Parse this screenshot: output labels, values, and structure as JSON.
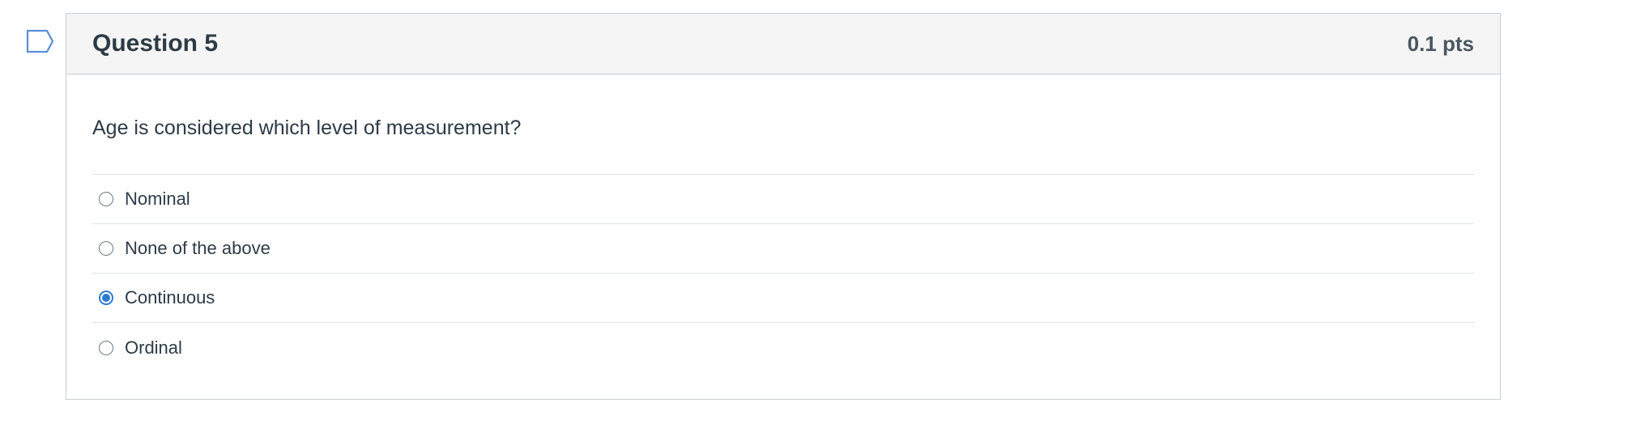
{
  "question": {
    "title": "Question 5",
    "points": "0.1 pts",
    "text": "Age is considered which level of measurement?",
    "answers": [
      {
        "label": "Nominal",
        "selected": false
      },
      {
        "label": "None of the above",
        "selected": false
      },
      {
        "label": "Continuous",
        "selected": true
      },
      {
        "label": "Ordinal",
        "selected": false
      }
    ]
  },
  "colors": {
    "accent": "#2b7bd4",
    "header_bg": "#f5f5f5",
    "border": "#c7cdd1",
    "text": "#2d3b45",
    "flag": "#5b8fd6"
  },
  "icons": {
    "flag": "bookmark-flag-icon",
    "radio": "radio-button"
  }
}
